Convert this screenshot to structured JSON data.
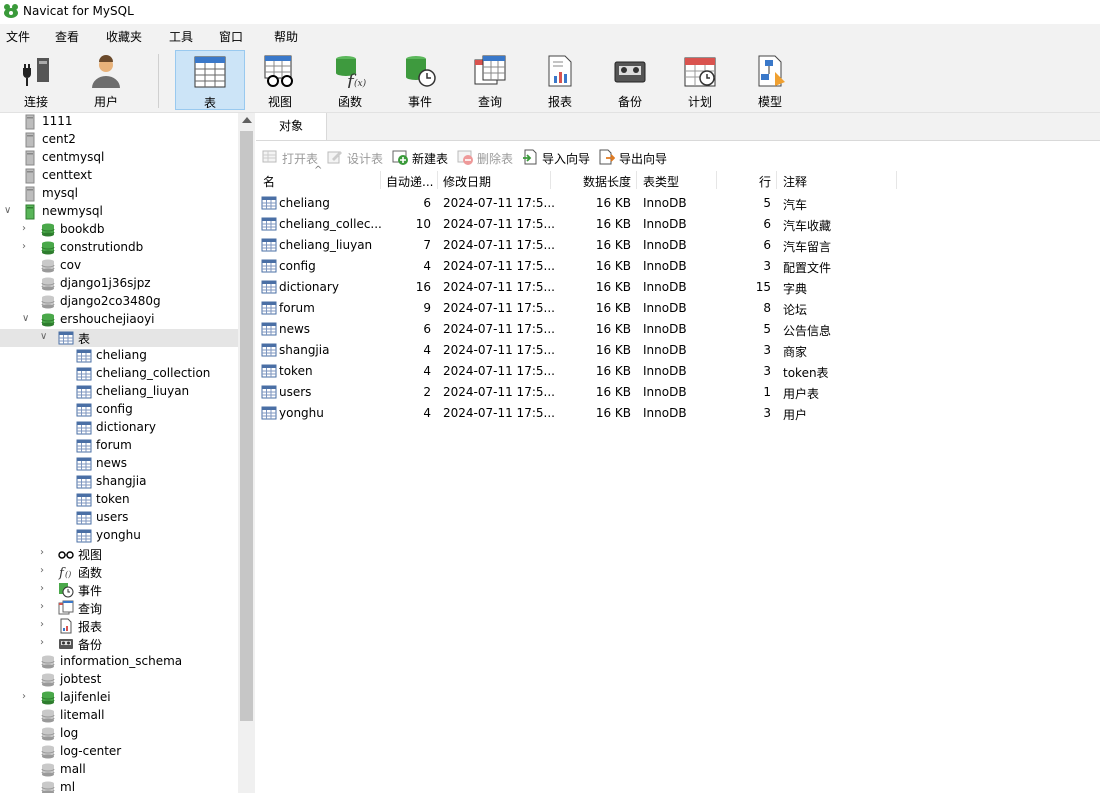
{
  "window": {
    "title": "Navicat for MySQL"
  },
  "menu": [
    "文件",
    "查看",
    "收藏夹",
    "工具",
    "窗口",
    "帮助"
  ],
  "toolbar": {
    "connect": "连接",
    "user": "用户",
    "table": "表",
    "view": "视图",
    "function": "函数",
    "event": "事件",
    "query": "查询",
    "report": "报表",
    "backup": "备份",
    "schedule": "计划",
    "model": "模型"
  },
  "sidebar": {
    "connections": [
      "1111",
      "cent2",
      "centmysql",
      "centtext",
      "mysql",
      "newmysql"
    ],
    "databases_before": [
      "bookdb",
      "construtiondb",
      "cov",
      "django1j36sjpz",
      "django2co3480g",
      "ershouchejiaoyi"
    ],
    "table_group": "表",
    "tables": [
      "cheliang",
      "cheliang_collection",
      "cheliang_liuyan",
      "config",
      "dictionary",
      "forum",
      "news",
      "shangjia",
      "token",
      "users",
      "yonghu"
    ],
    "subgroups": [
      "视图",
      "函数",
      "事件",
      "查询",
      "报表",
      "备份"
    ],
    "databases_after": [
      "information_schema",
      "jobtest",
      "lajifenlei",
      "litemall",
      "log",
      "log-center",
      "mall",
      "ml"
    ]
  },
  "main": {
    "tab": "对象",
    "actions": {
      "open": "打开表",
      "design": "设计表",
      "new": "新建表",
      "delete": "删除表",
      "import": "导入向导",
      "export": "导出向导"
    },
    "columns": {
      "name": "名",
      "auto_inc": "自动递...",
      "modified": "修改日期",
      "data_len": "数据长度",
      "engine": "表类型",
      "rows": "行",
      "comment": "注释"
    },
    "rows": [
      {
        "name": "cheliang",
        "auto_inc": "6",
        "modified": "2024-07-11 17:5...",
        "data_len": "16 KB",
        "engine": "InnoDB",
        "rows": "5",
        "comment": "汽车"
      },
      {
        "name": "cheliang_collec...",
        "auto_inc": "10",
        "modified": "2024-07-11 17:5...",
        "data_len": "16 KB",
        "engine": "InnoDB",
        "rows": "6",
        "comment": "汽车收藏"
      },
      {
        "name": "cheliang_liuyan",
        "auto_inc": "7",
        "modified": "2024-07-11 17:5...",
        "data_len": "16 KB",
        "engine": "InnoDB",
        "rows": "6",
        "comment": "汽车留言"
      },
      {
        "name": "config",
        "auto_inc": "4",
        "modified": "2024-07-11 17:5...",
        "data_len": "16 KB",
        "engine": "InnoDB",
        "rows": "3",
        "comment": "配置文件"
      },
      {
        "name": "dictionary",
        "auto_inc": "16",
        "modified": "2024-07-11 17:5...",
        "data_len": "16 KB",
        "engine": "InnoDB",
        "rows": "15",
        "comment": "字典"
      },
      {
        "name": "forum",
        "auto_inc": "9",
        "modified": "2024-07-11 17:5...",
        "data_len": "16 KB",
        "engine": "InnoDB",
        "rows": "8",
        "comment": "论坛"
      },
      {
        "name": "news",
        "auto_inc": "6",
        "modified": "2024-07-11 17:5...",
        "data_len": "16 KB",
        "engine": "InnoDB",
        "rows": "5",
        "comment": "公告信息"
      },
      {
        "name": "shangjia",
        "auto_inc": "4",
        "modified": "2024-07-11 17:5...",
        "data_len": "16 KB",
        "engine": "InnoDB",
        "rows": "3",
        "comment": "商家"
      },
      {
        "name": "token",
        "auto_inc": "4",
        "modified": "2024-07-11 17:5...",
        "data_len": "16 KB",
        "engine": "InnoDB",
        "rows": "3",
        "comment": "token表"
      },
      {
        "name": "users",
        "auto_inc": "2",
        "modified": "2024-07-11 17:5...",
        "data_len": "16 KB",
        "engine": "InnoDB",
        "rows": "1",
        "comment": "用户表"
      },
      {
        "name": "yonghu",
        "auto_inc": "4",
        "modified": "2024-07-11 17:5...",
        "data_len": "16 KB",
        "engine": "InnoDB",
        "rows": "3",
        "comment": "用户"
      }
    ]
  }
}
